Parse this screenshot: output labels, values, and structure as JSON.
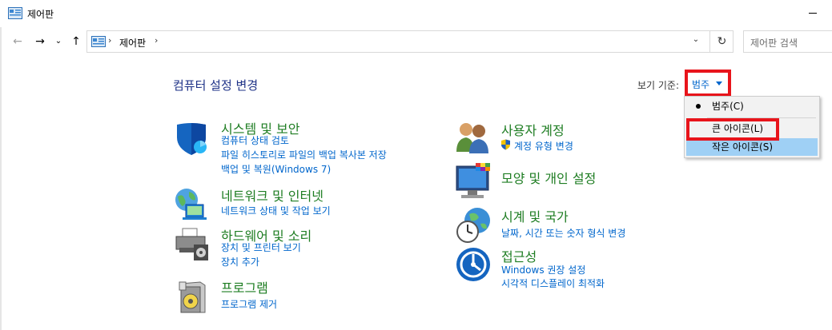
{
  "window": {
    "title": "제어판"
  },
  "address": {
    "crumb": "제어판",
    "search_placeholder": "제어판 검색"
  },
  "main": {
    "title": "컴퓨터 설정 변경",
    "view_label": "보기 기준:",
    "view_value": "범주"
  },
  "view_menu": {
    "items": [
      {
        "label": "범주(C)",
        "selected": true
      },
      {
        "label": "큰 아이콘(L)",
        "selected": false
      },
      {
        "label": "작은 아이콘(S)",
        "selected": false,
        "hovered": true
      }
    ]
  },
  "categories": {
    "system": {
      "title": "시스템 및 보안",
      "links": [
        "컴퓨터 상태 검토",
        "파일 히스토리로 파일의 백업 복사본 저장",
        "백업 및 복원(Windows 7)"
      ],
      "icon": "shield-icon"
    },
    "network": {
      "title": "네트워크 및 인터넷",
      "links": [
        "네트워크 상태 및 작업 보기"
      ],
      "icon": "network-globe-icon"
    },
    "hardware": {
      "title": "하드웨어 및 소리",
      "links": [
        "장치 및 프린터 보기",
        "장치 추가"
      ],
      "icon": "printer-icon"
    },
    "programs": {
      "title": "프로그램",
      "links": [
        "프로그램 제거"
      ],
      "icon": "programs-box-icon"
    },
    "users": {
      "title": "사용자 계정",
      "links": [
        "계정 유형 변경"
      ],
      "icon": "users-icon"
    },
    "appearance": {
      "title": "모양 및 개인 설정",
      "links": [],
      "icon": "monitor-palette-icon"
    },
    "clock": {
      "title": "시계 및 국가",
      "links": [
        "날짜, 시간 또는 숫자 형식 변경"
      ],
      "icon": "clock-globe-icon"
    },
    "ease": {
      "title": "접근성",
      "links": [
        "Windows 권장 설정",
        "시각적 디스플레이 최적화"
      ],
      "icon": "ease-of-access-icon"
    }
  },
  "colors": {
    "category_title": "#1e7d22",
    "link": "#0066cc",
    "highlight_box": "#e8141b",
    "menu_hover": "#9fd0f5"
  }
}
